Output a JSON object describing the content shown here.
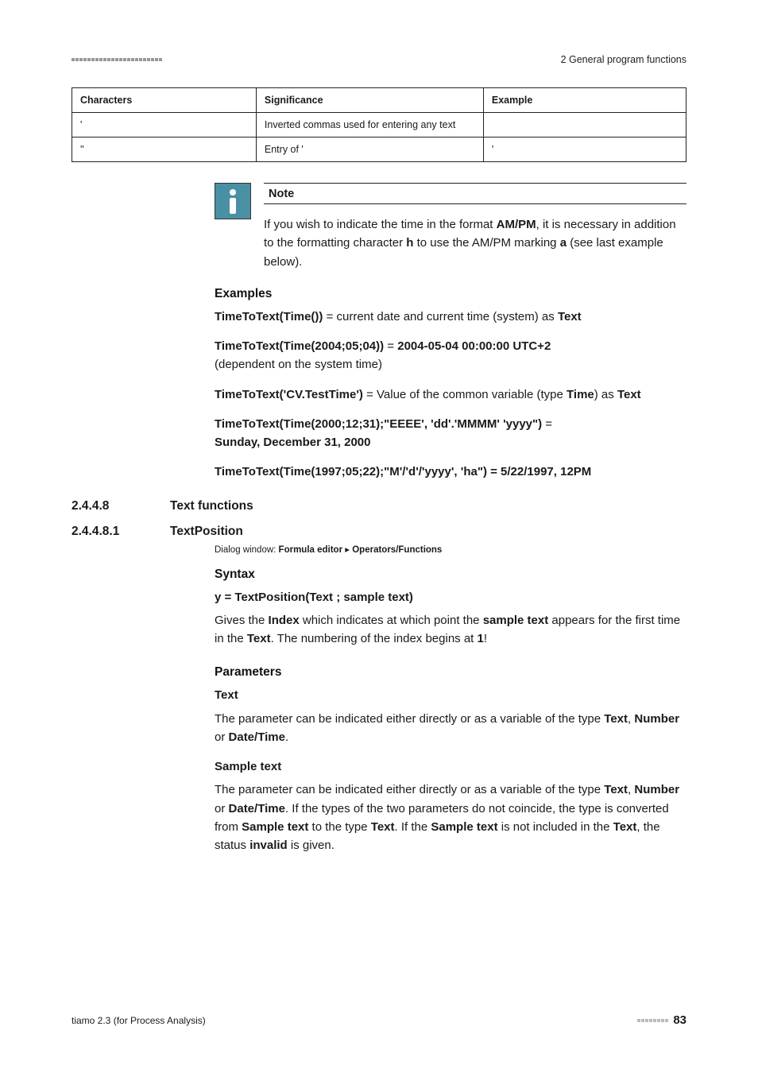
{
  "header": {
    "breadcrumb": "2 General program functions"
  },
  "table": {
    "headers": [
      "Characters",
      "Significance",
      "Example"
    ],
    "rows": [
      {
        "c": "'",
        "s": "Inverted commas used for entering any text",
        "e": ""
      },
      {
        "c": "''",
        "s": "Entry of '",
        "e": "'"
      }
    ]
  },
  "note": {
    "title": "Note",
    "body_pre": "If you wish to indicate the time in the format ",
    "body_ampm": "AM/PM",
    "body_mid1": ", it is necessary in addition to the formatting character ",
    "body_h": "h",
    "body_mid2": " to use the AM/PM marking ",
    "body_a": "a",
    "body_end": " (see last example below)."
  },
  "examples": {
    "heading": "Examples",
    "l1_a": "TimeToText(Time())",
    "l1_b": " = current date and current time (system) as ",
    "l1_c": "Text",
    "l2_a": "TimeToText(Time(2004;05;04))",
    "l2_eq": " = ",
    "l2_b": "2004-05-04 00:00:00 UTC+2",
    "l2_c": "(dependent on the system time)",
    "l3_a": "TimeToText('CV.TestTime')",
    "l3_b": " = Value of the common variable (type ",
    "l3_c": "Time",
    "l3_d": ") as ",
    "l3_e": "Text",
    "l4_a": "TimeToText(Time(2000;12;31);\"EEEE', 'dd'.'MMMM' 'yyyy\")",
    "l4_eq": " = ",
    "l4_b": "Sunday, December 31, 2000",
    "l5_a": "TimeToText(Time(1997;05;22);\"M'/'d'/'yyyy', 'ha\") = 5/22/1997, 12PM"
  },
  "sec1": {
    "num": "2.4.4.8",
    "title": "Text functions"
  },
  "sec2": {
    "num": "2.4.4.8.1",
    "title": "TextPosition"
  },
  "dialog": {
    "pre": "Dialog window: ",
    "a": "Formula editor",
    "sep": " ▸ ",
    "b": "Operators/Functions"
  },
  "syntax": {
    "heading": "Syntax",
    "line": "y = TextPosition(Text ; sample text)",
    "desc_a": "Gives the ",
    "desc_b": "Index",
    "desc_c": " which indicates at which point the ",
    "desc_d": "sample text",
    "desc_e": " appears for the first time in the ",
    "desc_f": "Text",
    "desc_g": ". The numbering of the index begins at ",
    "desc_h": "1",
    "desc_i": "!"
  },
  "params": {
    "heading": "Parameters",
    "p1_title": "Text",
    "p1_a": "The parameter can be indicated either directly or as a variable of the type ",
    "p1_b": "Text",
    "p1_c": ", ",
    "p1_d": "Number",
    "p1_e": " or ",
    "p1_f": "Date/Time",
    "p1_g": ".",
    "p2_title": "Sample text",
    "p2_a": "The parameter can be indicated either directly or as a variable of the type ",
    "p2_b": "Text",
    "p2_c": ", ",
    "p2_d": "Number",
    "p2_e": " or ",
    "p2_f": "Date/Time",
    "p2_g": ". If the types of the two parameters do not coincide, the type is converted from ",
    "p2_h": "Sample text",
    "p2_i": " to the type ",
    "p2_j": "Text",
    "p2_k": ". If the ",
    "p2_l": "Sample text",
    "p2_m": " is not included in the ",
    "p2_n": "Text",
    "p2_o": ", the status ",
    "p2_p": "invalid",
    "p2_q": " is given."
  },
  "footer": {
    "left": "tiamo 2.3 (for Process Analysis)",
    "page": "83"
  }
}
